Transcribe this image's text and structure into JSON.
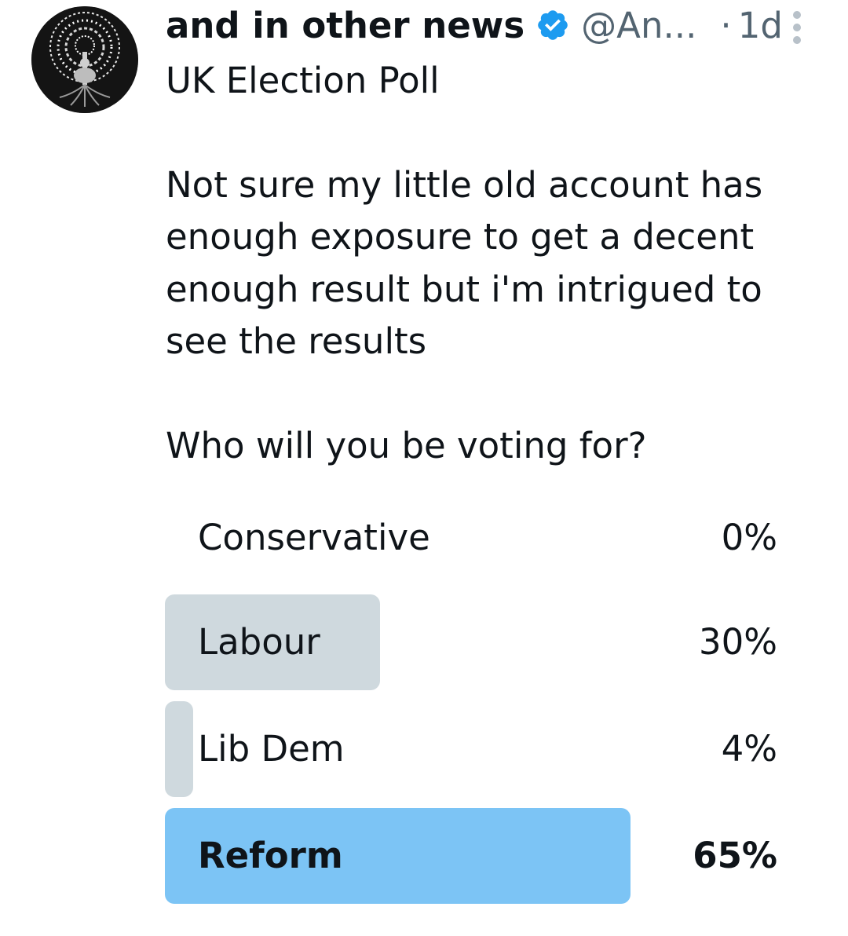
{
  "tweet": {
    "display_name": "and in other news",
    "handle": "@An...",
    "separator": "·",
    "time": "1d",
    "lines": [
      "UK Election Poll",
      "",
      "Not sure my little old account has enough exposure to get a decent enough result but i'm intrigued to see the results",
      "",
      "Who will you be voting for?"
    ]
  },
  "poll": {
    "options": [
      {
        "label": "Conservative",
        "percent_label": "0%",
        "percent": 0,
        "winner": false
      },
      {
        "label": "Labour",
        "percent_label": "30%",
        "percent": 30,
        "winner": false
      },
      {
        "label": "Lib Dem",
        "percent_label": "4%",
        "percent": 4,
        "winner": false
      },
      {
        "label": "Reform",
        "percent_label": "65%",
        "percent": 65,
        "winner": true
      }
    ]
  },
  "colors": {
    "bar": "#cfd9de",
    "winner_bar": "#7cc4f5",
    "verified": "#1d9bf0",
    "secondary_text": "#536471"
  },
  "icons": {
    "avatar": "tree-of-life-avatar",
    "verified": "verified-badge-icon",
    "more": "more-vertical-icon"
  }
}
